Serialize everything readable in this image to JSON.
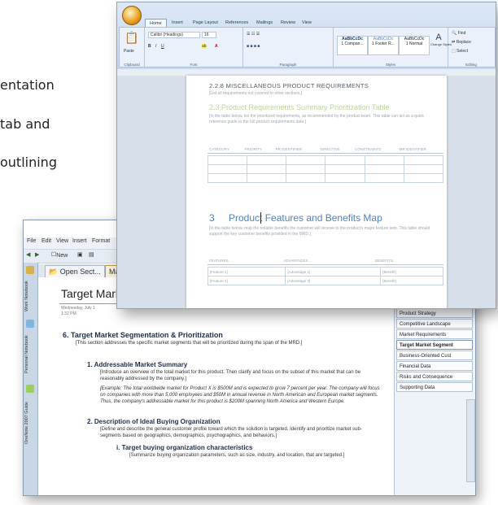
{
  "background": {
    "lines": [
      "entation",
      "tab and",
      "outlining"
    ]
  },
  "onenote": {
    "menu": [
      "File",
      "Edit",
      "View",
      "Insert",
      "Format"
    ],
    "toolbar": {
      "new_label": "New"
    },
    "tabs": [
      "Open Sect...",
      "Mar"
    ],
    "notebooks": [
      "Work Notebook",
      "Personal Notebook",
      "OneNote 2007 Guide"
    ],
    "page": {
      "title": "Target Mark",
      "date": "Wednesday, July 1",
      "time": "1:32 PM",
      "section_heading": "6.  Target Market Segmentation & Prioritization",
      "section_intro": "[This section addresses the specific market segments that will be prioritized during the span of the MRD.]",
      "items": [
        {
          "heading": "1.   Addressable Market Summary",
          "text": "[Introduce an overview of the total market for this product. Then clarify and focus on the subset of this market that can be reasonably addressed by the company.]",
          "example": "[Example: The total worldwide market for Product X is $500M and is expected to grow 7 percent per year. The company will focus on companies with more than 5,000 employees and $50M in annual revenue in North American and European market segments. Thus, the company's addressable market for this product is $200M spanning North America and Western Europe."
        },
        {
          "heading": "2.   Description of Ideal Buying Organization",
          "text": "[Define and describe the general customer profile toward which the solution is targeted. Identify and prioritize market sub-segments based on geographics, demographics, psychographics, and behaviors.]"
        }
      ],
      "subitem": {
        "heading": "i.   Target buying organization characteristics",
        "text": "[Summarize buying organization parameters, such as size, industry, and location, that are targeted.]"
      }
    },
    "page_tabs": [
      "Product Strategy",
      "Competitive Landscape",
      "Market Requirements",
      "Target Market Segment",
      "Business-Oriented Cust",
      "Financial Data",
      "Risks and Consequence",
      "Supporting Data"
    ],
    "active_page_tab": 3
  },
  "word": {
    "tabs": [
      "Home",
      "Insert",
      "Page Layout",
      "References",
      "Mailings",
      "Review",
      "View"
    ],
    "ribbon": {
      "paste_label": "Paste",
      "font_name": "Calibri (Headings)",
      "font_size": "16",
      "groups": [
        "Clipboard",
        "Font",
        "Paragraph",
        "Styles",
        "Editing"
      ],
      "styles": [
        "AaBbCcDc",
        "AaBbCcDc",
        "AaBbCcDc"
      ],
      "style_names": [
        "1 Compan...",
        "1 Footer R...",
        "1 Normal"
      ],
      "change_styles": "Change Styles",
      "find": "Find",
      "replace": "Replace",
      "select": "Select"
    },
    "doc": {
      "h228": "2.2.8    MISCELLANEOUS PRODUCT REQUIREMENTS",
      "h228_note": "[List all requirements not covered in other sections.]",
      "h23": "2.3    Product Requirements Summary Prioritization Table",
      "h23_note": "[In the table below, list the prioritized requirements, as recommended by the product team. This table can act as a quick reference guide to the full product requirements data.]",
      "table1_headers": [
        "CATEGORY",
        "PRIORITY",
        "PR IDENTIFIER",
        "DIRECTIVE",
        "CONSTRAINTS",
        "MR IDENTIFIER"
      ],
      "h3_number": "3",
      "h3_title": "Product Features and Benefits Map",
      "h3_note": "[In the table below, map the notable benefits the customer will receive to the product's major feature sets. This table should support the key customer benefits provided in the MRD.]",
      "table2_headers": [
        "FEATURES",
        "ADVANTAGES",
        "BENEFITS"
      ],
      "table2_rows": [
        [
          "[Feature 1]",
          "[Advantage 1]",
          "[Benefit]"
        ],
        [
          "[Feature 2]",
          "[Advantage 2]",
          "[Benefit]"
        ]
      ]
    }
  }
}
